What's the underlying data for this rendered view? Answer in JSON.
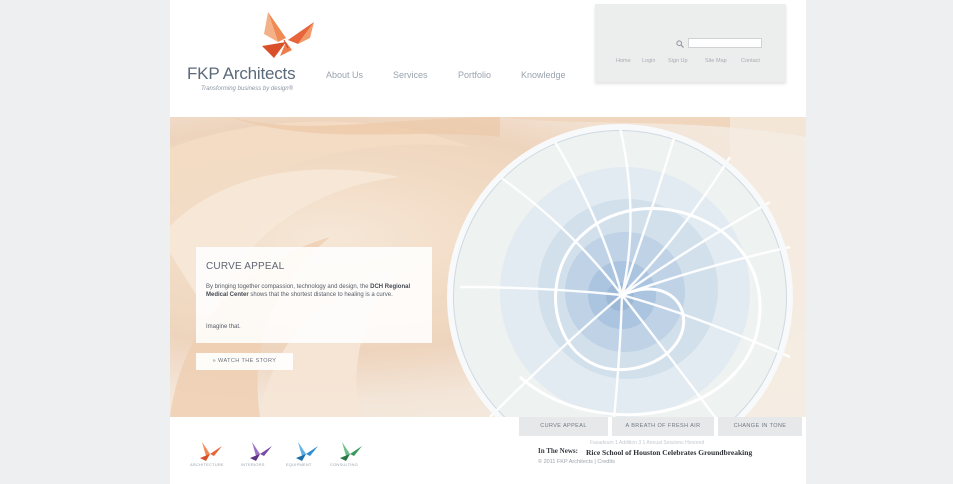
{
  "header": {
    "brand": "FKP Architects",
    "tagline": "Transforming business by design®",
    "nav": [
      "About Us",
      "Services",
      "Portfolio",
      "Knowledge"
    ]
  },
  "utility": {
    "search_placeholder": "",
    "links": [
      "Home",
      "Login",
      "Sign Up",
      "Site Map",
      "Contact"
    ]
  },
  "hero": {
    "title": "CURVE APPEAL",
    "body_1": "By bringing together compassion, technology and design, the ",
    "body_bold": "DCH Regional Medical Center",
    "body_2": " shows that the shortest distance to healing is a curve.",
    "tail": "Imagine that.",
    "cta": "» WATCH THE STORY"
  },
  "tabs": [
    "CURVE APPEAL",
    "A BREATH OF FRESH AIR",
    "CHANGE IN TONE"
  ],
  "categories": [
    {
      "label": "ARCHITECTURE",
      "color": "#e8643b"
    },
    {
      "label": "INTERIORS",
      "color": "#7b4aa3"
    },
    {
      "label": "EQUIPMENT",
      "color": "#2e8fd0"
    },
    {
      "label": "CONSULTING",
      "color": "#3a9a5e"
    }
  ],
  "news": {
    "label": "In The News:",
    "headline": "Rice School of Houston Celebrates Groundbreaking",
    "ghost": "Fasadeum 1 Addition 3 1 Annual Sessions Honored",
    "copyright": "© 2011 FKP Architects",
    "credits": "Credits"
  },
  "colors": {
    "brand_orange": "#e8643b",
    "brand_text": "#5b6a7a"
  }
}
